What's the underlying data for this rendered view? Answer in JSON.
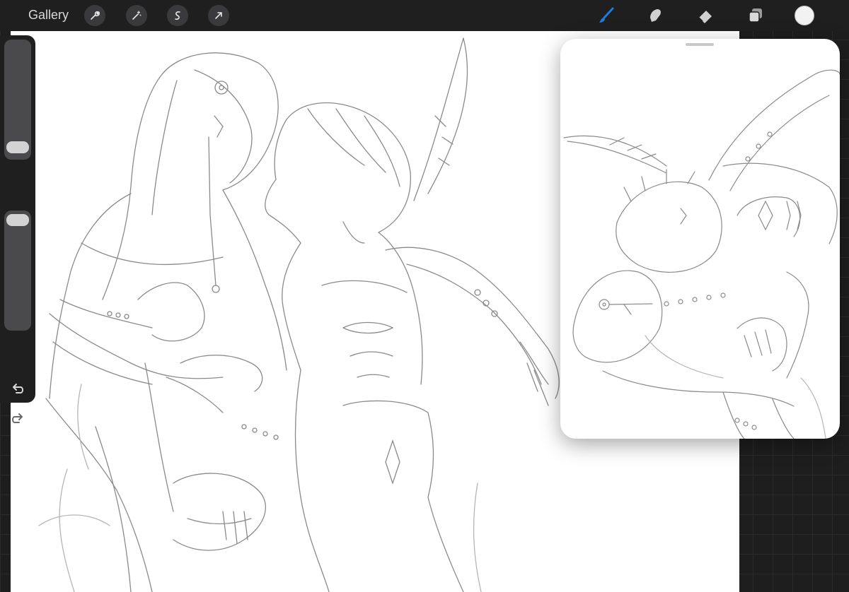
{
  "app": {
    "gallery_label": "Gallery"
  },
  "toolbar_left": {
    "icons": [
      "wrench-icon",
      "magic-wand-icon",
      "selection-icon",
      "transform-arrow-icon"
    ]
  },
  "toolbar_right": {
    "icons": [
      "brush-icon",
      "smudge-icon",
      "eraser-icon",
      "layers-icon"
    ],
    "active_tool": "brush",
    "active_color": "#1f7ae0",
    "current_color": "#f2f2f2"
  },
  "sidebar": {
    "brush_size_level": 0.9,
    "opacity_level": 0.05,
    "icons": [
      "modifier-square-icon",
      "undo-icon",
      "redo-icon"
    ]
  },
  "reference_window": {
    "visible": true
  }
}
